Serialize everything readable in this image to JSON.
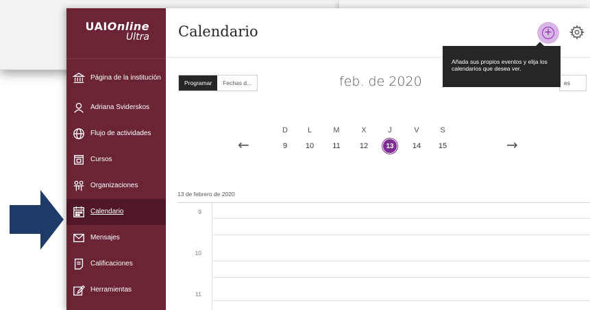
{
  "brand": {
    "name": "UAIOnline",
    "name_part1": "UAI",
    "name_part2": "Online",
    "name_sub": "Ultra"
  },
  "sidebar": {
    "items": [
      {
        "label": "Página de la institución",
        "icon": "institution-icon"
      },
      {
        "label": "Adriana Sviderskos",
        "icon": "user-icon"
      },
      {
        "label": "Flujo de actividades",
        "icon": "globe-icon"
      },
      {
        "label": "Cursos",
        "icon": "courses-icon"
      },
      {
        "label": "Organizaciones",
        "icon": "organizations-icon"
      },
      {
        "label": "Calendario",
        "icon": "calendar-icon",
        "active": true
      },
      {
        "label": "Mensajes",
        "icon": "mail-icon"
      },
      {
        "label": "Calificaciones",
        "icon": "grades-icon"
      },
      {
        "label": "Herramientas",
        "icon": "tools-icon"
      }
    ]
  },
  "header": {
    "title": "Calendario",
    "add_icon": "add-event-icon",
    "settings_icon": "gear-icon"
  },
  "tooltip": {
    "text": "Añada sus propios eventos y elija los calendarios que desea ver."
  },
  "toolbar": {
    "tab_schedule": "Programar",
    "tab_due": "Fechas d...",
    "month": "feb. de 2020",
    "right_tab": "es"
  },
  "week": {
    "days": [
      {
        "letter": "D",
        "num": "9"
      },
      {
        "letter": "L",
        "num": "10"
      },
      {
        "letter": "M",
        "num": "11"
      },
      {
        "letter": "X",
        "num": "12"
      },
      {
        "letter": "J",
        "num": "13",
        "today": true
      },
      {
        "letter": "V",
        "num": "14"
      },
      {
        "letter": "S",
        "num": "15"
      }
    ],
    "prev_icon": "arrow-left-icon",
    "next_icon": "arrow-right-icon"
  },
  "schedule": {
    "date_label": "13 de febrero de 2020",
    "hours": [
      "9",
      "10",
      "11"
    ]
  },
  "colors": {
    "sidebar": "#6b2433",
    "sidebar_active": "#4f1824",
    "accent": "#7e2b94",
    "pointer_arrow": "#1f3c68"
  }
}
